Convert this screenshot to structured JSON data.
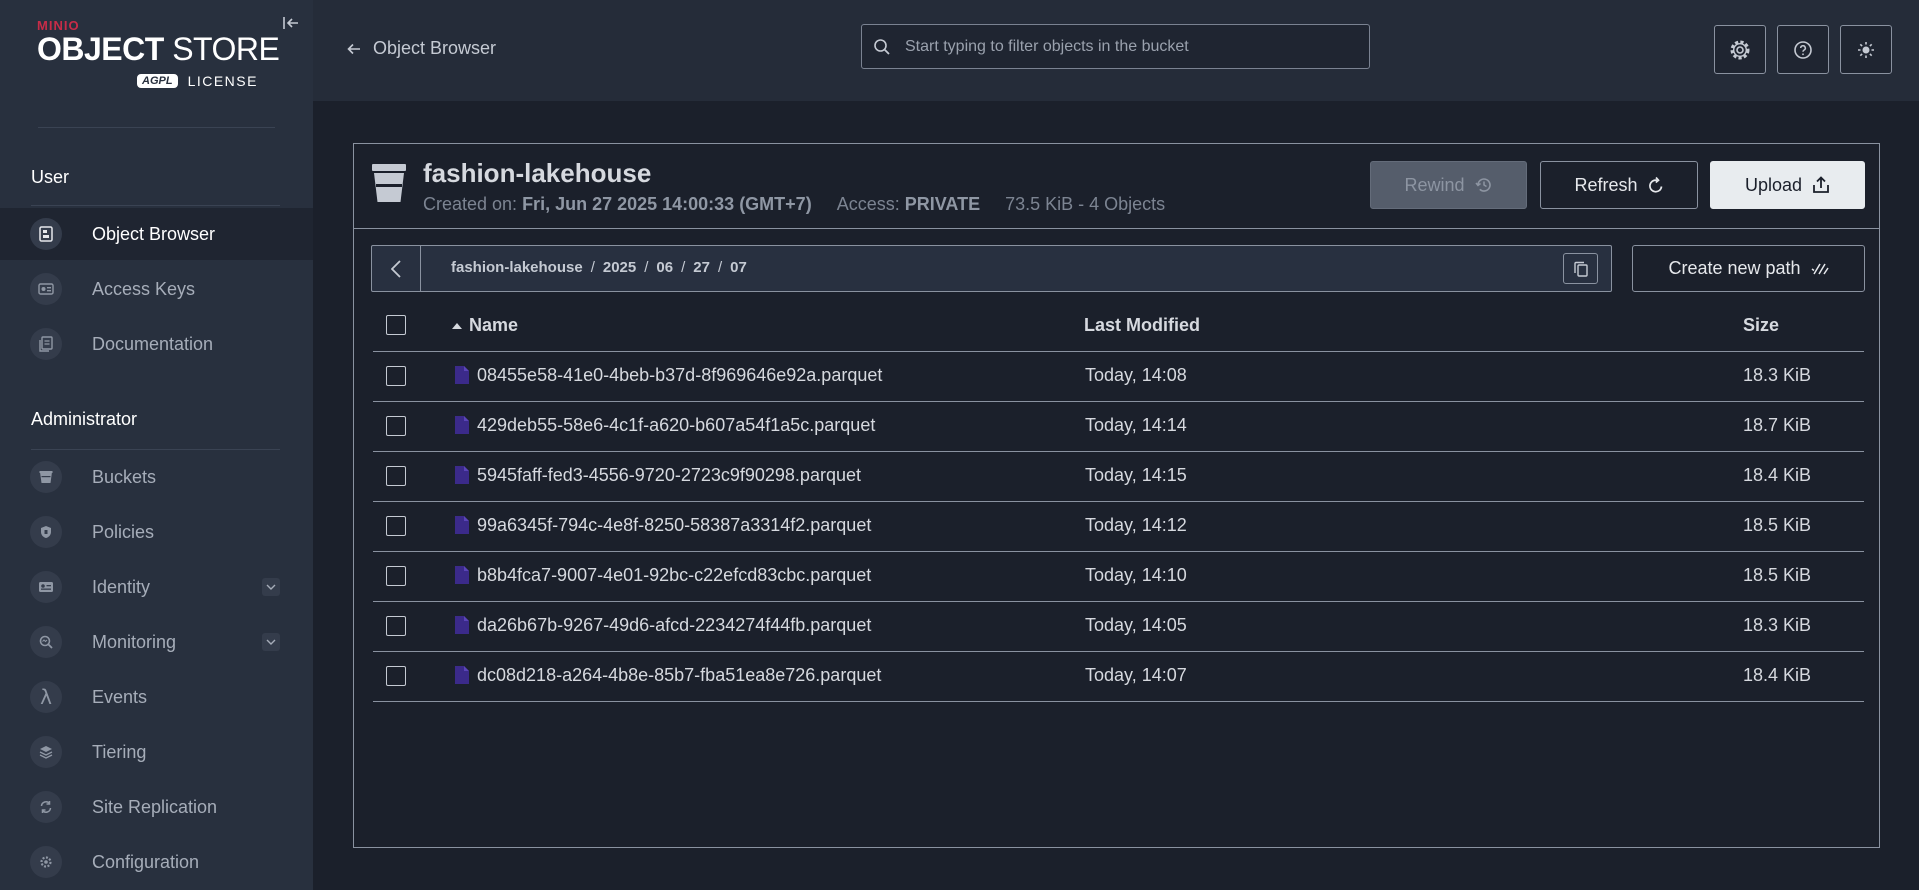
{
  "brand": {
    "minio": "MINIO",
    "product_bold": "OBJECT",
    "product_rest": " STORE",
    "agpl": "AGPL",
    "license": "LICENSE"
  },
  "sidebar": {
    "user_section": "User",
    "admin_section": "Administrator",
    "user_items": [
      {
        "label": "Object Browser",
        "icon": "object-browser-icon"
      },
      {
        "label": "Access Keys",
        "icon": "access-keys-icon"
      },
      {
        "label": "Documentation",
        "icon": "documentation-icon"
      }
    ],
    "admin_items": [
      {
        "label": "Buckets",
        "icon": "bucket-icon"
      },
      {
        "label": "Policies",
        "icon": "policy-icon"
      },
      {
        "label": "Identity",
        "icon": "identity-icon"
      },
      {
        "label": "Monitoring",
        "icon": "monitoring-icon"
      },
      {
        "label": "Events",
        "icon": "lambda-icon"
      },
      {
        "label": "Tiering",
        "icon": "tiering-icon"
      },
      {
        "label": "Site Replication",
        "icon": "replication-icon"
      },
      {
        "label": "Configuration",
        "icon": "configuration-icon"
      }
    ]
  },
  "header": {
    "back_label": "Object Browser",
    "search_placeholder": "Start typing to filter objects in the bucket"
  },
  "bucket": {
    "name": "fashion-lakehouse",
    "created_label": "Created on: ",
    "created_value": "Fri, Jun 27 2025 14:00:33 (GMT+7)",
    "access_label": "Access: ",
    "access_value": "PRIVATE",
    "usage": "73.5 KiB - 4 Objects"
  },
  "actions": {
    "rewind": "Rewind",
    "refresh": "Refresh",
    "upload": "Upload",
    "create_path": "Create new path"
  },
  "breadcrumb": [
    "fashion-lakehouse",
    "2025",
    "06",
    "27",
    "07"
  ],
  "table": {
    "columns": {
      "name": "Name",
      "modified": "Last Modified",
      "size": "Size"
    },
    "rows": [
      {
        "name": "08455e58-41e0-4beb-b37d-8f969646e92a.parquet",
        "modified": "Today, 14:08",
        "size": "18.3 KiB"
      },
      {
        "name": "429deb55-58e6-4c1f-a620-b607a54f1a5c.parquet",
        "modified": "Today, 14:14",
        "size": "18.7 KiB"
      },
      {
        "name": "5945faff-fed3-4556-9720-2723c9f90298.parquet",
        "modified": "Today, 14:15",
        "size": "18.4 KiB"
      },
      {
        "name": "99a6345f-794c-4e8f-8250-58387a3314f2.parquet",
        "modified": "Today, 14:12",
        "size": "18.5 KiB"
      },
      {
        "name": "b8b4fca7-9007-4e01-92bc-c22efcd83cbc.parquet",
        "modified": "Today, 14:10",
        "size": "18.5 KiB"
      },
      {
        "name": "da26b67b-9267-49d6-afcd-2234274f44fb.parquet",
        "modified": "Today, 14:05",
        "size": "18.3 KiB"
      },
      {
        "name": "dc08d218-a264-4b8e-85b7-fba51ea8e726.parquet",
        "modified": "Today, 14:07",
        "size": "18.4 KiB"
      }
    ]
  },
  "colors": {
    "brand_red": "#c72c48",
    "file_icon": "#3b2a8a"
  }
}
